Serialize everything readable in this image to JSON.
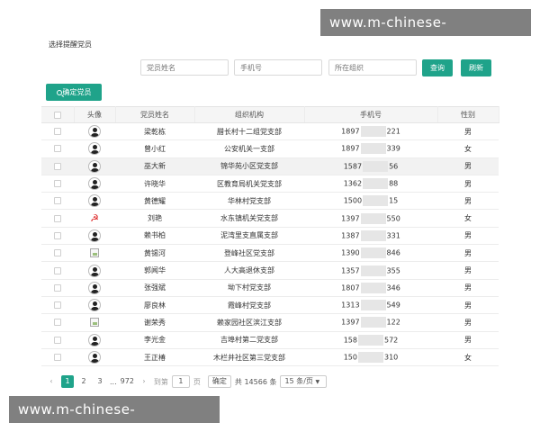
{
  "watermark": "www.m-chinese-kaiyun.com",
  "panel": {
    "title": "选择提醒党员"
  },
  "filters": {
    "name_placeholder": "党员姓名",
    "phone_placeholder": "手机号",
    "org_placeholder": "所在组织",
    "search_label": "查询",
    "refresh_label": "刷新"
  },
  "confirm_label": "确定党员",
  "icons": {
    "confirm": "search-icon",
    "avatar": "user-avatar-icon",
    "broken": "broken-image-icon",
    "party": "party-emblem-icon"
  },
  "colors": {
    "accent": "#1fa38a",
    "highlight_row": "#f2f2f2"
  },
  "table": {
    "headers": [
      "头像",
      "党员姓名",
      "组织机构",
      "手机号",
      "性别"
    ],
    "rows": [
      {
        "avatar": "user",
        "name": "梁乾栋",
        "org": "腊长村十二组党支部",
        "phone_prefix": "1897",
        "phone_suffix": "221",
        "gender": "男"
      },
      {
        "avatar": "user",
        "name": "曾小红",
        "org": "公安机关一支部",
        "phone_prefix": "1897",
        "phone_suffix": "339",
        "gender": "女"
      },
      {
        "avatar": "user",
        "name": "巫大新",
        "org": "锦华苑小区党支部",
        "phone_prefix": "1587",
        "phone_suffix": "56",
        "gender": "男",
        "highlight": true
      },
      {
        "avatar": "user",
        "name": "许晓华",
        "org": "区教育局机关党支部",
        "phone_prefix": "1362",
        "phone_suffix": "88",
        "gender": "男"
      },
      {
        "avatar": "user",
        "name": "黄德耀",
        "org": "华林村党支部",
        "phone_prefix": "1500",
        "phone_suffix": "15",
        "gender": "男"
      },
      {
        "avatar": "party",
        "name": "刘艳",
        "org": "水东镇机关党支部",
        "phone_prefix": "1397",
        "phone_suffix": "550",
        "gender": "女"
      },
      {
        "avatar": "user",
        "name": "赖书柏",
        "org": "泥湾里支直属支部",
        "phone_prefix": "1387",
        "phone_suffix": "331",
        "gender": "男"
      },
      {
        "avatar": "broken",
        "name": "黄锡河",
        "org": "登峰社区党支部",
        "phone_prefix": "1390",
        "phone_suffix": "846",
        "gender": "男"
      },
      {
        "avatar": "user",
        "name": "郭闻华",
        "org": "人大高退休支部",
        "phone_prefix": "1357",
        "phone_suffix": "355",
        "gender": "男"
      },
      {
        "avatar": "user",
        "name": "张强斌",
        "org": "坳下村党支部",
        "phone_prefix": "1807",
        "phone_suffix": "346",
        "gender": "男"
      },
      {
        "avatar": "user",
        "name": "廖良林",
        "org": "霞峰村党支部",
        "phone_prefix": "1313",
        "phone_suffix": "549",
        "gender": "男"
      },
      {
        "avatar": "broken",
        "name": "谢荣秀",
        "org": "赖家园社区滨江支部",
        "phone_prefix": "1397",
        "phone_suffix": "122",
        "gender": "男"
      },
      {
        "avatar": "user",
        "name": "李光金",
        "org": "吉埠村第二党支部",
        "phone_prefix": "158",
        "phone_suffix": "572",
        "gender": "男"
      },
      {
        "avatar": "user",
        "name": "王正椿",
        "org": "木栏井社区第三党支部",
        "phone_prefix": "150",
        "phone_suffix": "310",
        "gender": "女"
      }
    ]
  },
  "pagination": {
    "prev": "‹",
    "pages": [
      "1",
      "2",
      "3"
    ],
    "ellipsis": "...",
    "last_page": "972",
    "next": "›",
    "goto_label": "到第",
    "goto_value": "1",
    "page_unit": "页",
    "confirm": "确定",
    "total": "共 14566 条",
    "per_page": "15 条/页",
    "dropdown_arrow": "▼"
  }
}
